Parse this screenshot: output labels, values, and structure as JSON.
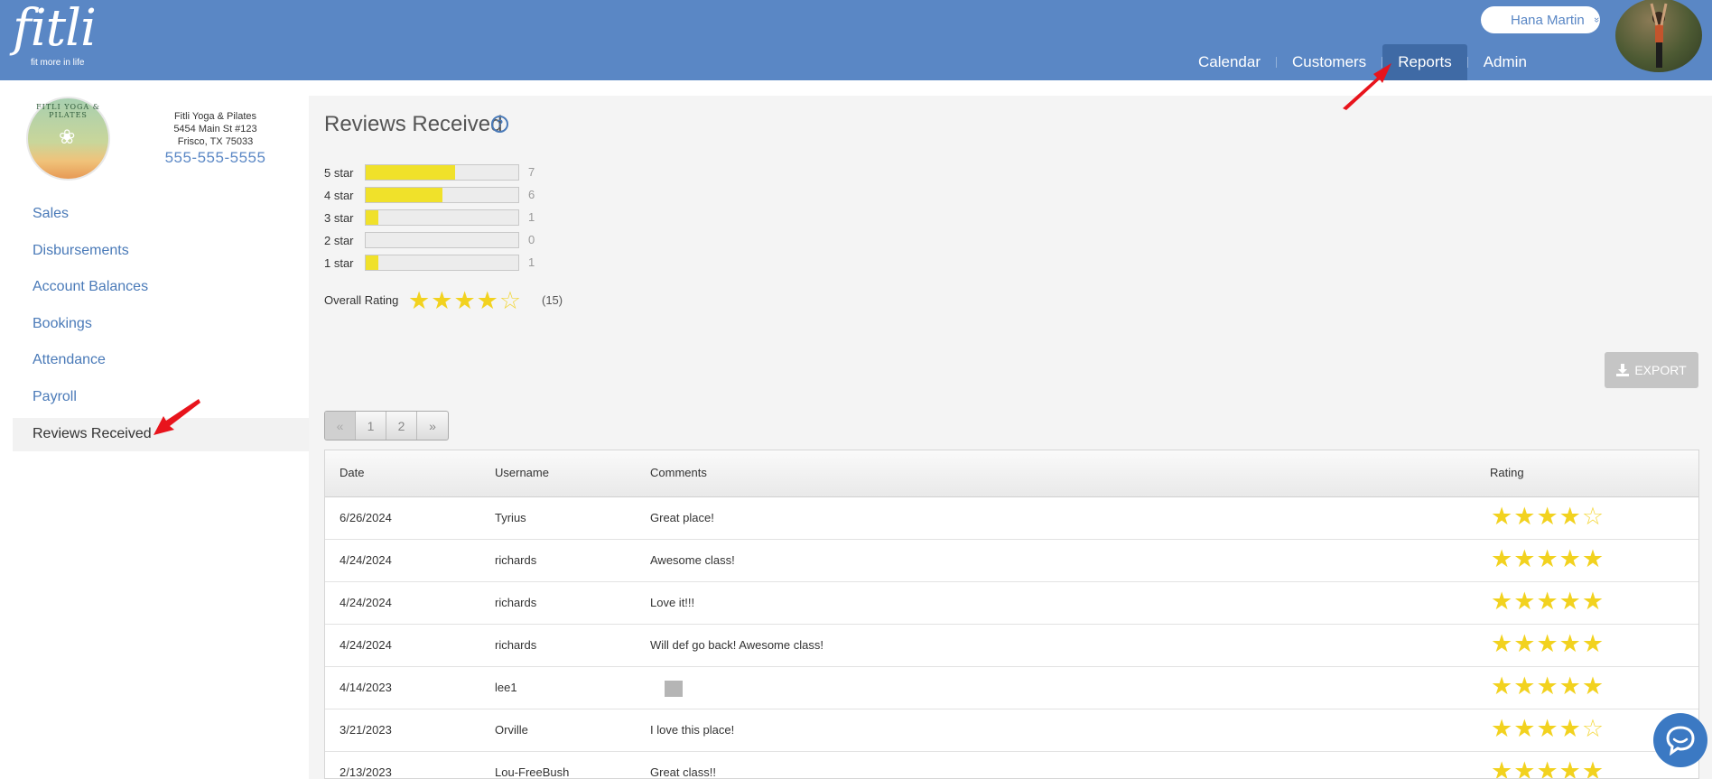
{
  "app": {
    "logo_text": "fitli",
    "logo_tagline": "fit more in life"
  },
  "user": {
    "name": "Hana Martin",
    "chevron": "»"
  },
  "nav": [
    {
      "label": "Calendar",
      "active": false
    },
    {
      "label": "Customers",
      "active": false
    },
    {
      "label": "Reports",
      "active": true
    },
    {
      "label": "Admin",
      "active": false
    }
  ],
  "business": {
    "logo_text": "FITLI YOGA & PILATES",
    "name": "Fitli Yoga & Pilates",
    "address1": "5454 Main St #123",
    "address2": "Frisco, TX 75033",
    "phone": "555-555-5555"
  },
  "sidebar": {
    "items": [
      {
        "label": "Sales"
      },
      {
        "label": "Disbursements"
      },
      {
        "label": "Account Balances"
      },
      {
        "label": "Bookings"
      },
      {
        "label": "Attendance"
      },
      {
        "label": "Payroll"
      },
      {
        "label": "Reviews Received",
        "active": true
      }
    ]
  },
  "main": {
    "title": "Reviews Received",
    "help_icon": "?",
    "distribution": [
      {
        "label": "5 star",
        "count": 7
      },
      {
        "label": "4 star",
        "count": 6
      },
      {
        "label": "3 star",
        "count": 1
      },
      {
        "label": "2 star",
        "count": 0
      },
      {
        "label": "1 star",
        "count": 1
      }
    ],
    "overall": {
      "label": "Overall Rating",
      "rating": 4,
      "count_text": "(15)"
    },
    "export_label": "EXPORT",
    "pagination": [
      "«",
      "1",
      "2",
      "»"
    ]
  },
  "table": {
    "columns": [
      "Date",
      "Username",
      "Comments",
      "Rating"
    ],
    "rows": [
      {
        "date": "6/26/2024",
        "username": "Tyrius",
        "comment": "Great place!",
        "rating": 4
      },
      {
        "date": "4/24/2024",
        "username": "richards",
        "comment": "Awesome class!",
        "rating": 5
      },
      {
        "date": "4/24/2024",
        "username": "richards",
        "comment": "Love it!!!",
        "rating": 5
      },
      {
        "date": "4/24/2024",
        "username": "richards",
        "comment": "Will def go back! Awesome class!",
        "rating": 5
      },
      {
        "date": "4/14/2023",
        "username": "lee1",
        "comment": "",
        "rating": 5,
        "image": true
      },
      {
        "date": "3/21/2023",
        "username": "Orville",
        "comment": "I love this place!",
        "rating": 4
      },
      {
        "date": "2/13/2023",
        "username": "Lou-FreeBush",
        "comment": "Great class!!",
        "rating": 5
      }
    ]
  },
  "colors": {
    "header": "#5a87c5",
    "nav_active": "#3f6aa5",
    "link": "#4a7ab8",
    "star": "#f2d21f",
    "bar_fill": "#f0e12a",
    "annotation_arrow": "#e8141c"
  },
  "icons": [
    "user-chevron-icon",
    "help-icon",
    "download-icon",
    "star-icon",
    "chat-icon",
    "annotation-arrow-icon"
  ]
}
